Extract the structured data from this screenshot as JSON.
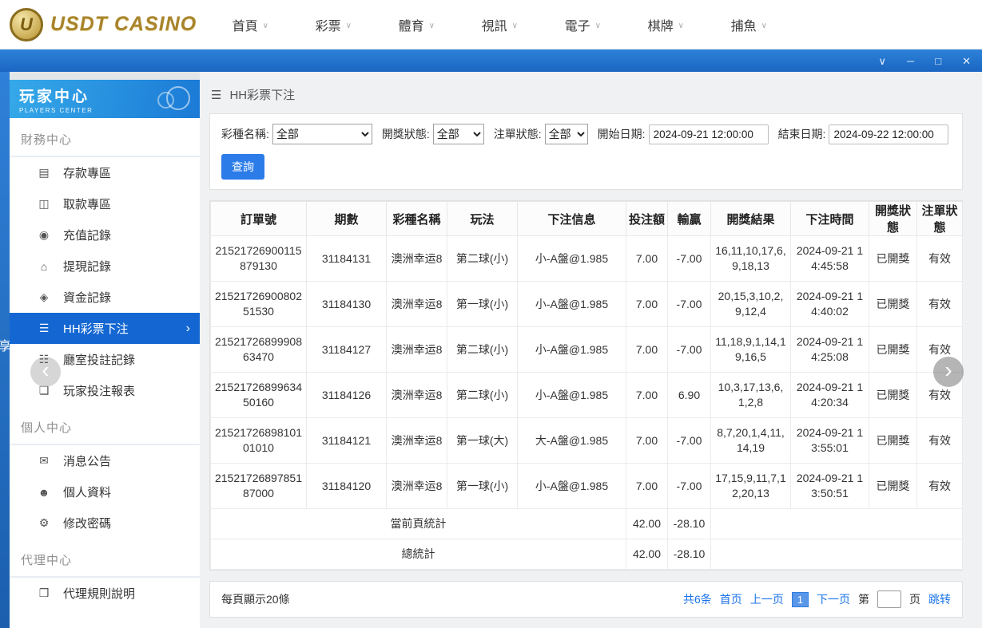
{
  "background": {
    "partial_text": "享"
  },
  "icons": {
    "nav_caret": "∨",
    "window_collapse": "∨",
    "window_minimize": "─",
    "window_maximize": "□",
    "window_close": "✕",
    "hamburger": "☰",
    "chevron_right": "›",
    "carousel_left": "‹",
    "carousel_right": "›"
  },
  "colors": {
    "accent_blue": "#1f79e0",
    "titlebar_blue": "#1d6fd0",
    "sidebar_active_blue": "#1467d2",
    "logo_gold": "#a8842c",
    "link_blue": "#1a73e8"
  },
  "topnav": {
    "logo_initial": "U",
    "logo_text": "USDT CASINO",
    "items": [
      {
        "key": "home",
        "label": "首頁"
      },
      {
        "key": "lottery",
        "label": "彩票"
      },
      {
        "key": "sports",
        "label": "體育"
      },
      {
        "key": "video",
        "label": "視訊"
      },
      {
        "key": "electronic",
        "label": "電子"
      },
      {
        "key": "chess",
        "label": "棋牌"
      },
      {
        "key": "fishing",
        "label": "捕魚"
      }
    ]
  },
  "sidebar": {
    "title": "玩家中心",
    "subtitle": "PLAYERS CENTER",
    "sections": [
      {
        "key": "finance",
        "label": "財務中心",
        "items": [
          {
            "key": "deposit-area",
            "label": "存款專區",
            "icon": "▤",
            "icon_name": "deposit-icon"
          },
          {
            "key": "withdraw-area",
            "label": "取款專區",
            "icon": "◫",
            "icon_name": "withdraw-icon"
          },
          {
            "key": "recharge-records",
            "label": "充值記錄",
            "icon": "◉",
            "icon_name": "recharge-record-icon"
          },
          {
            "key": "withdrawal-records",
            "label": "提現記錄",
            "icon": "⌂",
            "icon_name": "withdrawal-record-icon"
          },
          {
            "key": "funds-records",
            "label": "資金記錄",
            "icon": "◈",
            "icon_name": "funds-record-icon"
          },
          {
            "key": "hh-lottery-bets",
            "label": "HH彩票下注",
            "icon": "☰",
            "icon_name": "lottery-bets-icon",
            "active": true
          },
          {
            "key": "room-bet-records",
            "label": "廳室投註記錄",
            "icon": "☷",
            "icon_name": "room-bet-records-icon"
          },
          {
            "key": "player-bet-report",
            "label": "玩家投注報表",
            "icon": "❏",
            "icon_name": "player-bet-report-icon"
          }
        ]
      },
      {
        "key": "personal",
        "label": "個人中心",
        "items": [
          {
            "key": "announcements",
            "label": "消息公告",
            "icon": "✉",
            "icon_name": "announcement-icon"
          },
          {
            "key": "profile",
            "label": "個人資料",
            "icon": "☻",
            "icon_name": "profile-icon"
          },
          {
            "key": "change-password",
            "label": "修改密碼",
            "icon": "⚙",
            "icon_name": "password-gear-icon"
          }
        ]
      },
      {
        "key": "agent",
        "label": "代理中心",
        "items": [
          {
            "key": "agent-rules",
            "label": "代理規則說明",
            "icon": "❒",
            "icon_name": "agent-rules-icon"
          }
        ]
      }
    ]
  },
  "breadcrumb": {
    "title": "HH彩票下注"
  },
  "filters": {
    "lottery_label": "彩種名稱:",
    "lottery_value": "全部",
    "draw_status_label": "開獎狀態:",
    "draw_status_value": "全部",
    "order_status_label": "注單狀態:",
    "order_status_value": "全部",
    "start_date_label": "開始日期:",
    "start_date_value": "2024-09-21 12:00:00",
    "end_date_label": "結束日期:",
    "end_date_value": "2024-09-22 12:00:00",
    "search_button": "查詢"
  },
  "table": {
    "headers": [
      "訂單號",
      "期數",
      "彩種名稱",
      "玩法",
      "下注信息",
      "投注額",
      "輸贏",
      "開獎結果",
      "下注時間",
      "開獎狀態",
      "注單狀態"
    ],
    "fields": [
      "order_no",
      "period",
      "lottery",
      "play",
      "bet_info",
      "bet_amount",
      "win_loss",
      "draw_result",
      "bet_time",
      "draw_status",
      "order_status"
    ],
    "rows": [
      {
        "order_no": "21521726900115879130",
        "period": "31184131",
        "lottery": "澳洲幸运8",
        "play": "第二球(小)",
        "bet_info": "小-A盤@1.985",
        "bet_amount": "7.00",
        "win_loss": "-7.00",
        "draw_result": "16,11,10,17,6,9,18,13",
        "bet_time": "2024-09-21 14:45:58",
        "draw_status": "已開獎",
        "order_status": "有效"
      },
      {
        "order_no": "2152172690080251530",
        "period": "31184130",
        "lottery": "澳洲幸运8",
        "play": "第一球(小)",
        "bet_info": "小-A盤@1.985",
        "bet_amount": "7.00",
        "win_loss": "-7.00",
        "draw_result": "20,15,3,10,2,9,12,4",
        "bet_time": "2024-09-21 14:40:02",
        "draw_status": "已開獎",
        "order_status": "有效"
      },
      {
        "order_no": "2152172689990863470",
        "period": "31184127",
        "lottery": "澳洲幸运8",
        "play": "第二球(小)",
        "bet_info": "小-A盤@1.985",
        "bet_amount": "7.00",
        "win_loss": "-7.00",
        "draw_result": "11,18,9,1,14,19,16,5",
        "bet_time": "2024-09-21 14:25:08",
        "draw_status": "已開獎",
        "order_status": "有效"
      },
      {
        "order_no": "2152172689963450160",
        "period": "31184126",
        "lottery": "澳洲幸运8",
        "play": "第二球(小)",
        "bet_info": "小-A盤@1.985",
        "bet_amount": "7.00",
        "win_loss": "6.90",
        "draw_result": "10,3,17,13,6,1,2,8",
        "bet_time": "2024-09-21 14:20:34",
        "draw_status": "已開獎",
        "order_status": "有效"
      },
      {
        "order_no": "2152172689810101010",
        "period": "31184121",
        "lottery": "澳洲幸运8",
        "play": "第一球(大)",
        "bet_info": "大-A盤@1.985",
        "bet_amount": "7.00",
        "win_loss": "-7.00",
        "draw_result": "8,7,20,1,4,11,14,19",
        "bet_time": "2024-09-21 13:55:01",
        "draw_status": "已開獎",
        "order_status": "有效"
      },
      {
        "order_no": "2152172689785187000",
        "period": "31184120",
        "lottery": "澳洲幸运8",
        "play": "第一球(小)",
        "bet_info": "小-A盤@1.985",
        "bet_amount": "7.00",
        "win_loss": "-7.00",
        "draw_result": "17,15,9,11,7,12,20,13",
        "bet_time": "2024-09-21 13:50:51",
        "draw_status": "已開獎",
        "order_status": "有效"
      }
    ],
    "summary_rows": [
      {
        "label": "當前頁統計",
        "bet_amount": "42.00",
        "win_loss": "-28.10"
      },
      {
        "label": "總統計",
        "bet_amount": "42.00",
        "win_loss": "-28.10"
      }
    ]
  },
  "pagination": {
    "page_size_text": "每頁顯示20條",
    "total_text": "共6条",
    "first": "首页",
    "prev": "上一页",
    "current_page": "1",
    "next": "下一页",
    "jump_prefix": "第",
    "jump_suffix": "页",
    "jump_action": "跳转",
    "jump_value": ""
  }
}
